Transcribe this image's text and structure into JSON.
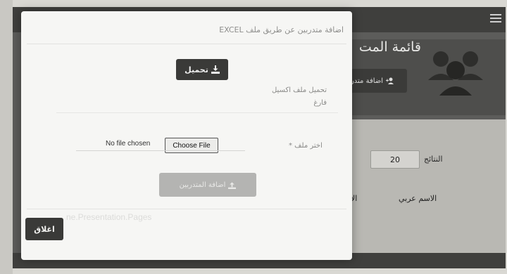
{
  "background": {
    "heading": "قائمة المت",
    "add_button_label": "اضافة متدر",
    "show_label": "النتائج",
    "page_size": "20",
    "column_arabic_name": "الاسم عربي",
    "column_cut": "الا",
    "icons": [
      "users-icon",
      "hamburger-icon",
      "add-user-icon"
    ]
  },
  "modal": {
    "title": "اضافة متدربين عن طريق ملف EXCEL",
    "download_label_line1": "تحميل ملف اكسيل",
    "download_label_line2": "فارغ",
    "download_button": "تحميل",
    "choose_label": "اختر ملف *",
    "file_input": {
      "button": "Choose File",
      "status": "No file chosen"
    },
    "submit_button": "اضافة المتدربين",
    "close_button": "اغلاق",
    "ghost_text": "ne.Presentation.Pages"
  },
  "colors": {
    "dark_button": "#3a3a38",
    "disabled_button": "#b4b4b2",
    "overlay": "#5c5c5a"
  }
}
